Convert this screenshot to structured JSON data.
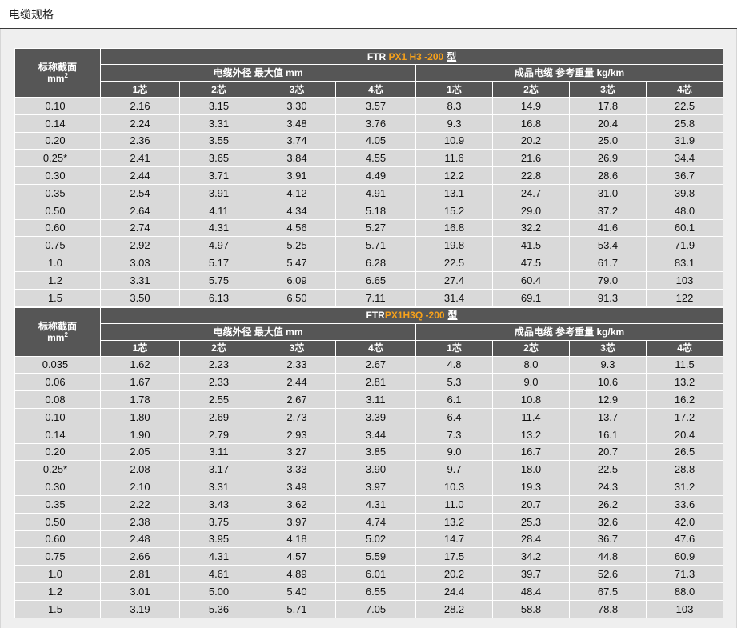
{
  "section": {
    "title": "电缆规格"
  },
  "colors": {
    "header_bg": "#565656",
    "cell_bg": "#d9d9d9",
    "panel_bg": "#efefef",
    "model_highlight": "#f7a11a"
  },
  "tables": [
    {
      "corner_label": "标称截面",
      "corner_unit": "mm",
      "corner_unit_sup": "2",
      "title_prefix": "FTR ",
      "title_model": "PX1 H3 -200",
      "title_suffix": "型",
      "group_headers": [
        "电缆外径   最大值   mm",
        "成品电缆   参考重量   kg/km"
      ],
      "core_headers": [
        "1芯",
        "2芯",
        "3芯",
        "4芯",
        "1芯",
        "2芯",
        "3芯",
        "4芯"
      ],
      "rows": [
        [
          "0.10",
          "2.16",
          "3.15",
          "3.30",
          "3.57",
          "8.3",
          "14.9",
          "17.8",
          "22.5"
        ],
        [
          "0.14",
          "2.24",
          "3.31",
          "3.48",
          "3.76",
          "9.3",
          "16.8",
          "20.4",
          "25.8"
        ],
        [
          "0.20",
          "2.36",
          "3.55",
          "3.74",
          "4.05",
          "10.9",
          "20.2",
          "25.0",
          "31.9"
        ],
        [
          "0.25*",
          "2.41",
          "3.65",
          "3.84",
          "4.55",
          "11.6",
          "21.6",
          "26.9",
          "34.4"
        ],
        [
          "0.30",
          "2.44",
          "3.71",
          "3.91",
          "4.49",
          "12.2",
          "22.8",
          "28.6",
          "36.7"
        ],
        [
          "0.35",
          "2.54",
          "3.91",
          "4.12",
          "4.91",
          "13.1",
          "24.7",
          "31.0",
          "39.8"
        ],
        [
          "0.50",
          "2.64",
          "4.11",
          "4.34",
          "5.18",
          "15.2",
          "29.0",
          "37.2",
          "48.0"
        ],
        [
          "0.60",
          "2.74",
          "4.31",
          "4.56",
          "5.27",
          "16.8",
          "32.2",
          "41.6",
          "60.1"
        ],
        [
          "0.75",
          "2.92",
          "4.97",
          "5.25",
          "5.71",
          "19.8",
          "41.5",
          "53.4",
          "71.9"
        ],
        [
          "1.0",
          "3.03",
          "5.17",
          "5.47",
          "6.28",
          "22.5",
          "47.5",
          "61.7",
          "83.1"
        ],
        [
          "1.2",
          "3.31",
          "5.75",
          "6.09",
          "6.65",
          "27.4",
          "60.4",
          "79.0",
          "103"
        ],
        [
          "1.5",
          "3.50",
          "6.13",
          "6.50",
          "7.11",
          "31.4",
          "69.1",
          "91.3",
          "122"
        ]
      ]
    },
    {
      "corner_label": "标称截面",
      "corner_unit": "mm",
      "corner_unit_sup": "2",
      "title_prefix": "FTR",
      "title_model": "PX1H3Q -200",
      "title_suffix": "型",
      "group_headers": [
        "电缆外径   最大值   mm",
        "成品电缆   参考重量   kg/km"
      ],
      "core_headers": [
        "1芯",
        "2芯",
        "3芯",
        "4芯",
        "1芯",
        "2芯",
        "3芯",
        "4芯"
      ],
      "rows": [
        [
          "0.035",
          "1.62",
          "2.23",
          "2.33",
          "2.67",
          "4.8",
          "8.0",
          "9.3",
          "11.5"
        ],
        [
          "0.06",
          "1.67",
          "2.33",
          "2.44",
          "2.81",
          "5.3",
          "9.0",
          "10.6",
          "13.2"
        ],
        [
          "0.08",
          "1.78",
          "2.55",
          "2.67",
          "3.11",
          "6.1",
          "10.8",
          "12.9",
          "16.2"
        ],
        [
          "0.10",
          "1.80",
          "2.69",
          "2.73",
          "3.39",
          "6.4",
          "11.4",
          "13.7",
          "17.2"
        ],
        [
          "0.14",
          "1.90",
          "2.79",
          "2.93",
          "3.44",
          "7.3",
          "13.2",
          "16.1",
          "20.4"
        ],
        [
          "0.20",
          "2.05",
          "3.11",
          "3.27",
          "3.85",
          "9.0",
          "16.7",
          "20.7",
          "26.5"
        ],
        [
          "0.25*",
          "2.08",
          "3.17",
          "3.33",
          "3.90",
          "9.7",
          "18.0",
          "22.5",
          "28.8"
        ],
        [
          "0.30",
          "2.10",
          "3.31",
          "3.49",
          "3.97",
          "10.3",
          "19.3",
          "24.3",
          "31.2"
        ],
        [
          "0.35",
          "2.22",
          "3.43",
          "3.62",
          "4.31",
          "11.0",
          "20.7",
          "26.2",
          "33.6"
        ],
        [
          "0.50",
          "2.38",
          "3.75",
          "3.97",
          "4.74",
          "13.2",
          "25.3",
          "32.6",
          "42.0"
        ],
        [
          "0.60",
          "2.48",
          "3.95",
          "4.18",
          "5.02",
          "14.7",
          "28.4",
          "36.7",
          "47.6"
        ],
        [
          "0.75",
          "2.66",
          "4.31",
          "4.57",
          "5.59",
          "17.5",
          "34.2",
          "44.8",
          "60.9"
        ],
        [
          "1.0",
          "2.81",
          "4.61",
          "4.89",
          "6.01",
          "20.2",
          "39.7",
          "52.6",
          "71.3"
        ],
        [
          "1.2",
          "3.01",
          "5.00",
          "5.40",
          "6.55",
          "24.4",
          "48.4",
          "67.5",
          "88.0"
        ],
        [
          "1.5",
          "3.19",
          "5.36",
          "5.71",
          "7.05",
          "28.2",
          "58.8",
          "78.8",
          "103"
        ]
      ]
    }
  ]
}
